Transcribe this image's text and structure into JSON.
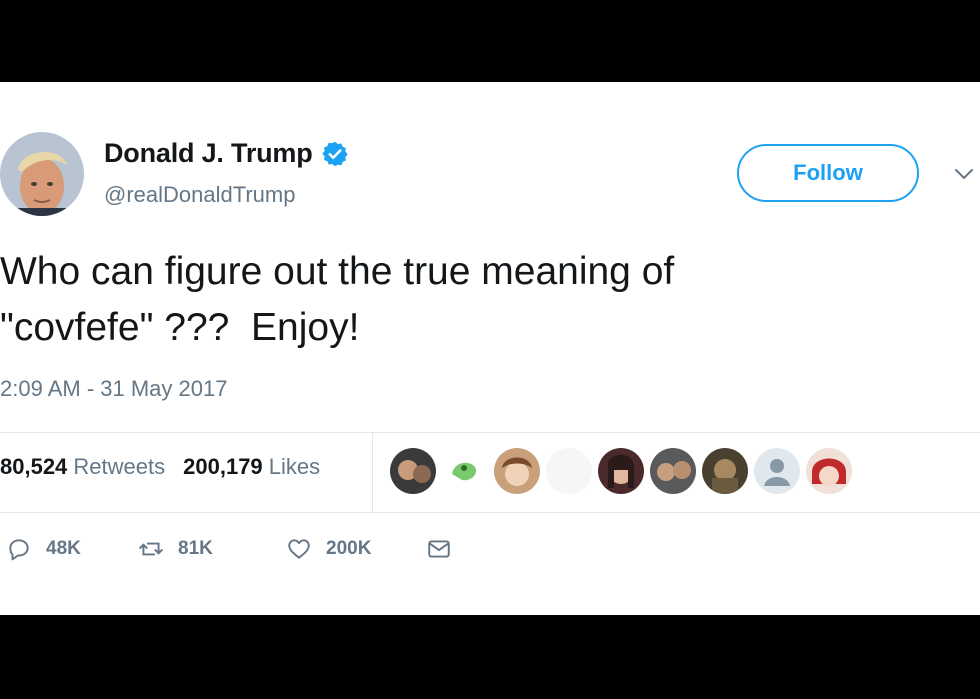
{
  "user": {
    "display_name": "Donald J. Trump",
    "handle": "@realDonaldTrump",
    "verified_icon": "verified-badge-icon"
  },
  "follow_label": "Follow",
  "tweet": {
    "text": "Who can figure out the true meaning of\n\"covfefe\" ???  Enjoy!",
    "timestamp": "2:09 AM - 31 May 2017"
  },
  "stats": {
    "retweets_count": "80,524",
    "retweets_label": "Retweets",
    "likes_count": "200,179",
    "likes_label": "Likes"
  },
  "actions": {
    "reply_count": "48K",
    "retweet_count": "81K",
    "like_count": "200K"
  },
  "colors": {
    "accent": "#1da1f2",
    "text": "#14171a",
    "muted": "#657786",
    "border": "#e1e8ed"
  }
}
